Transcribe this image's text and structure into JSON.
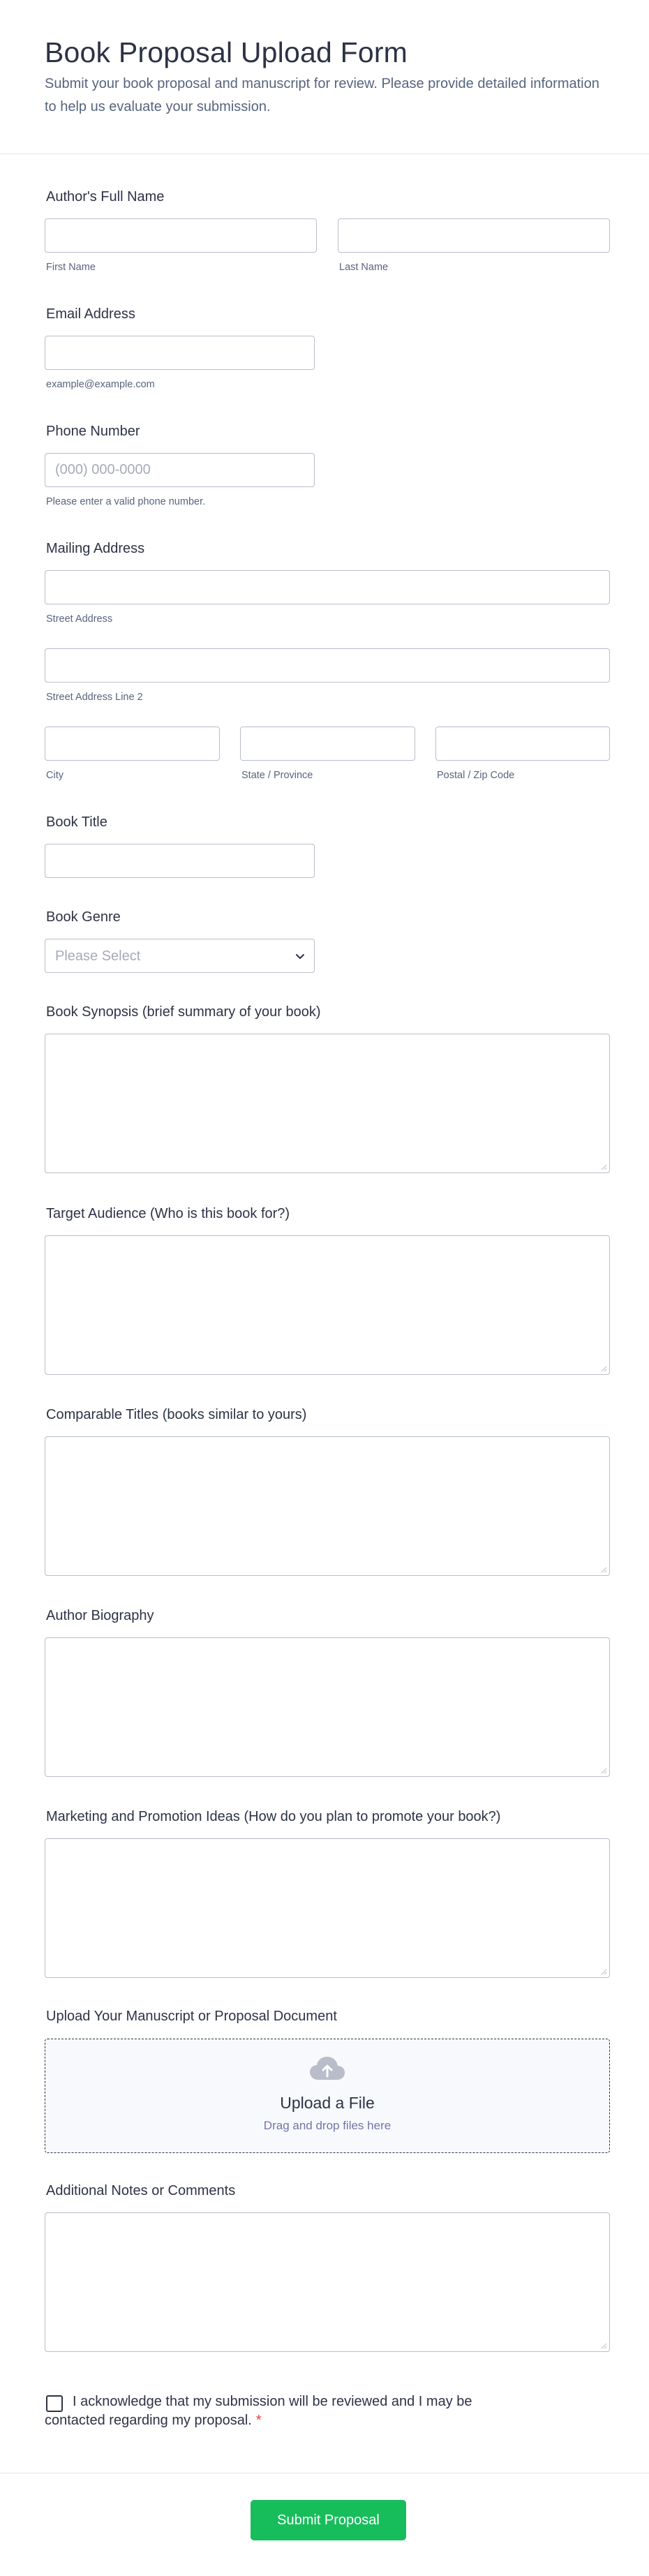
{
  "header": {
    "title": "Book Proposal Upload Form",
    "subtitle": "Submit your book proposal and manuscript for review. Please provide detailed information to help us evaluate your submission."
  },
  "author_name": {
    "label": "Author's Full Name",
    "first": "First Name",
    "last": "Last Name"
  },
  "email": {
    "label": "Email Address",
    "sublabel": "example@example.com"
  },
  "phone": {
    "label": "Phone Number",
    "placeholder": "(000) 000-0000",
    "sublabel": "Please enter a valid phone number."
  },
  "address": {
    "label": "Mailing Address",
    "street": "Street Address",
    "street2": "Street Address Line 2",
    "city": "City",
    "state": "State / Province",
    "zip": "Postal / Zip Code"
  },
  "book_title": {
    "label": "Book Title"
  },
  "book_genre": {
    "label": "Book Genre",
    "selected": "Please Select"
  },
  "synopsis": {
    "label": "Book Synopsis (brief summary of your book)"
  },
  "audience": {
    "label": "Target Audience (Who is this book for?)"
  },
  "comparable": {
    "label": "Comparable Titles (books similar to yours)"
  },
  "bio": {
    "label": "Author Biography"
  },
  "marketing": {
    "label": "Marketing and Promotion Ideas (How do you plan to promote your book?)"
  },
  "upload": {
    "label": "Upload Your Manuscript or Proposal Document",
    "title": "Upload a File",
    "subtitle": "Drag and drop files here"
  },
  "notes": {
    "label": "Additional Notes or Comments"
  },
  "acknowledge": {
    "text": "I acknowledge that my submission will be reviewed and I may be contacted regarding my proposal.",
    "required_mark": "*"
  },
  "submit": {
    "label": "Submit Proposal"
  },
  "colors": {
    "accent": "#18bd5b",
    "required": "#f23a3c",
    "text": "#2c3345",
    "muted": "#57647e"
  },
  "icons": {
    "upload": "cloud-upload-icon",
    "select": "chevron-down-icon"
  }
}
